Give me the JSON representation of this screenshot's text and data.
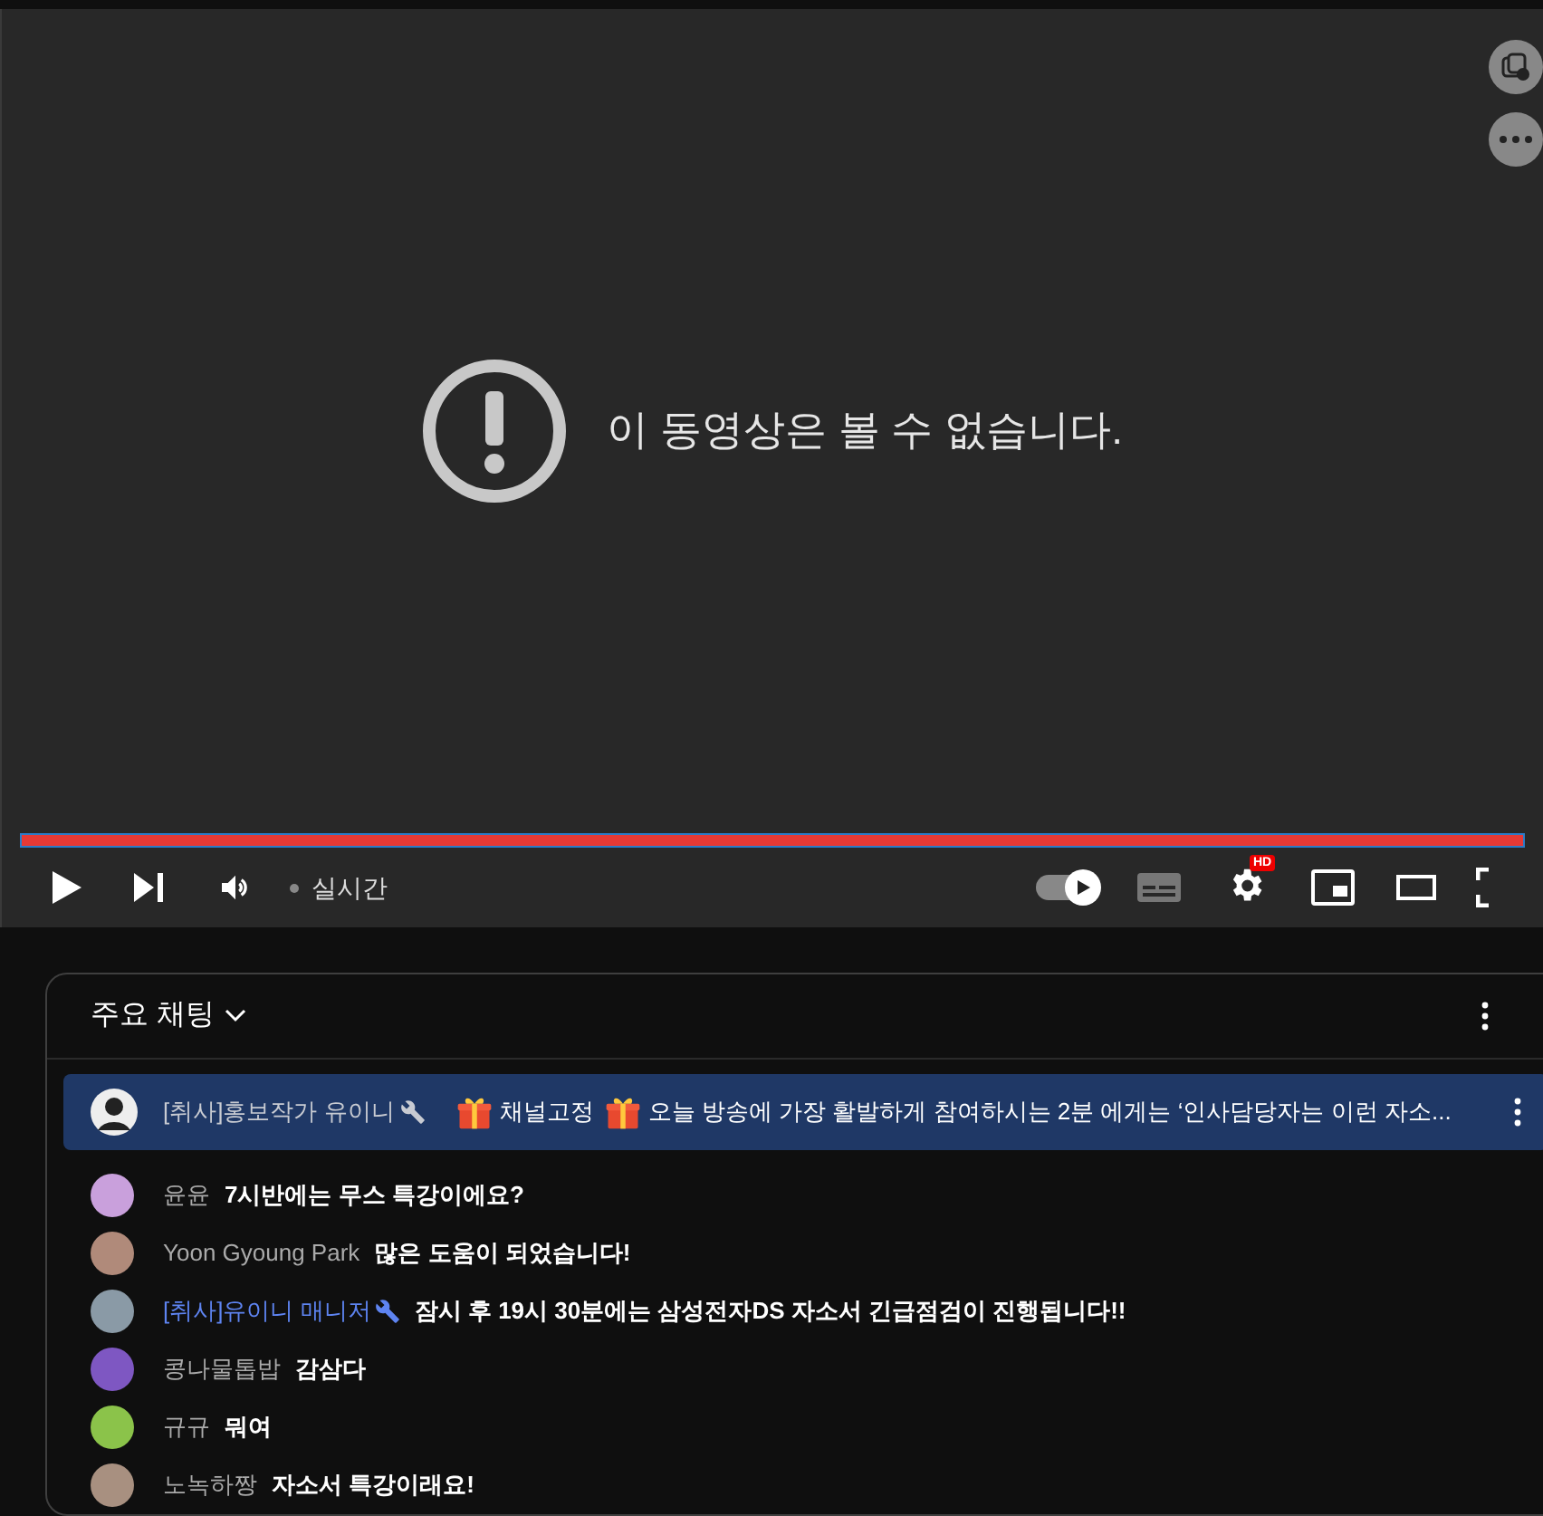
{
  "player": {
    "message": "이 동영상은 볼 수 없습니다.",
    "live_label": "실시간",
    "progress": {
      "level": 1
    },
    "autoplay": {
      "on": true
    },
    "quality_badge": "HD"
  },
  "chat": {
    "title": "주요 채팅",
    "pinned": {
      "author": "[취사]홍보작가 유이니",
      "moderator": true,
      "parts": [
        {
          "kind": "gift"
        },
        {
          "kind": "text",
          "text": "채널고정"
        },
        {
          "kind": "gift"
        },
        {
          "kind": "text",
          "text": "오늘 방송에 가장 활발하게 참여하시는 2분 에게는 ‘인사담당자는 이런 자소..."
        }
      ]
    },
    "messages": [
      {
        "author": "윤윤",
        "moderator": false,
        "color": "#c9a0dc",
        "text": "7시반에는 무스 특강이에요?"
      },
      {
        "author": "Yoon Gyoung Park",
        "moderator": false,
        "color": "#b08a7a",
        "text": "많은 도움이 되었습니다!"
      },
      {
        "author": "[취사]유이니 매니저",
        "moderator": true,
        "color": "#8a9aa6",
        "text": "잠시 후 19시 30분에는 삼성전자DS 자소서 긴급점검이 진행됩니다!!"
      },
      {
        "author": "콩나물톱밥",
        "moderator": false,
        "color": "#7e57c2",
        "text": "감삼다"
      },
      {
        "author": "규규",
        "moderator": false,
        "color": "#8bc34a",
        "text": "뭐여"
      },
      {
        "author": "노녹하짱",
        "moderator": false,
        "color": "#a89080",
        "text": "자소서 특강이래요!"
      }
    ]
  }
}
